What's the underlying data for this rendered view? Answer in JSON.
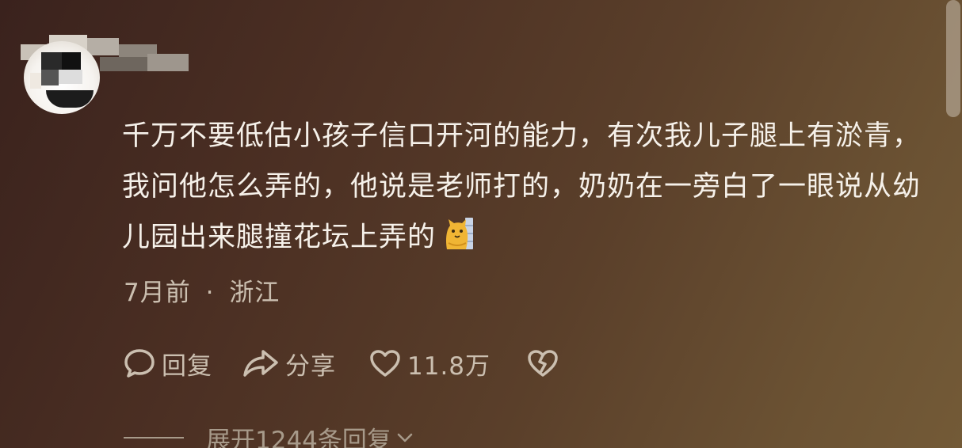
{
  "comment": {
    "text": "千万不要低估小孩子信口开河的能力，有次我儿子腿上有淤青，我问他怎么弄的，他说是老师打的，奶奶在一旁白了一眼说从幼儿园出来腿撞花坛上弄的",
    "emoji": "cat-emoji",
    "time": "7月前",
    "separator": "·",
    "location": "浙江"
  },
  "actions": {
    "reply_label": "回复",
    "share_label": "分享",
    "like_count": "11.8万"
  },
  "replies": {
    "expand_label": "展开1244条回复"
  },
  "colors": {
    "text": "#f6f1ea",
    "secondary": "#cbbfb0",
    "background_from": "#3a221d",
    "background_to": "#735a37"
  }
}
